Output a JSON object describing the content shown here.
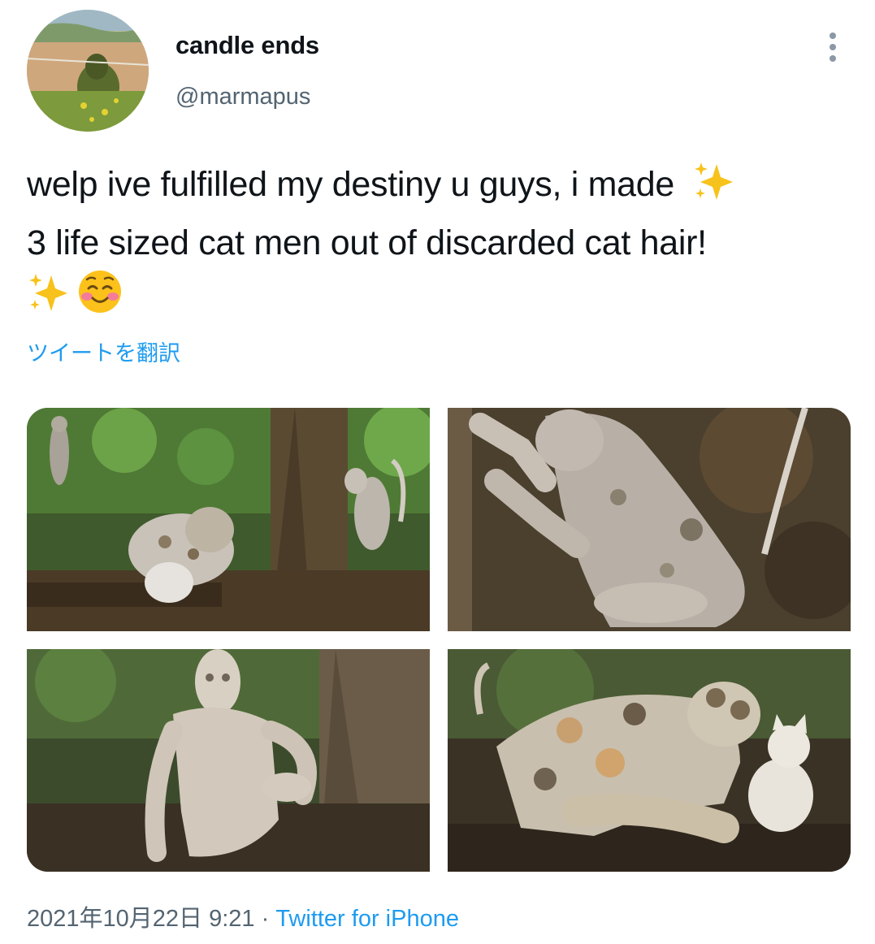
{
  "author": {
    "display_name": "candle ends",
    "handle": "@marmapus",
    "avatar_icon": "profile-photo"
  },
  "tweet": {
    "line1": "welp ive fulfilled my destiny u guys, i made",
    "line2": "3 life sized cat men out of discarded cat hair!",
    "emojis": [
      "sparkles",
      "sparkles",
      "smiling-face"
    ]
  },
  "translate_label": "ツイートを翻訳",
  "media": [
    {
      "icon": "photo-cat-sculptures-forest-wide"
    },
    {
      "icon": "photo-cat-man-climbing-tree"
    },
    {
      "icon": "photo-cat-man-standing-tree"
    },
    {
      "icon": "photo-calico-cat-man-with-cat"
    }
  ],
  "meta": {
    "timestamp": "2021年10月22日 9:21",
    "separator": " · ",
    "source": "Twitter for iPhone"
  },
  "colors": {
    "accent": "#1d9bf0",
    "secondary_text": "#536471",
    "primary_text": "#0f1419"
  }
}
